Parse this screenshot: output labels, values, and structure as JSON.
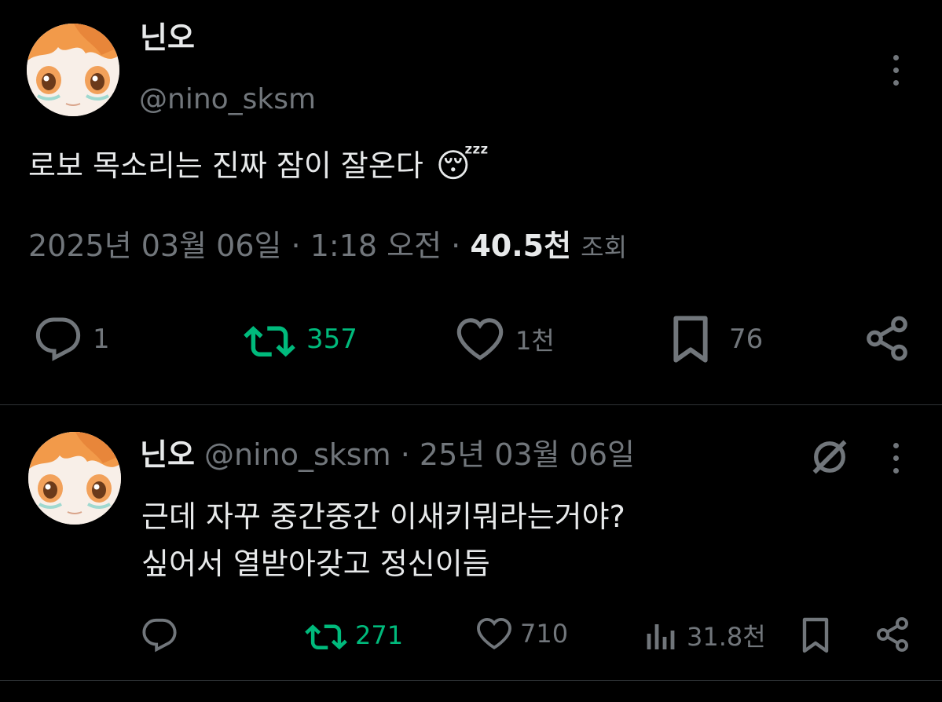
{
  "colors": {
    "background": "#000000",
    "text": "#e7e9ea",
    "muted": "#71767b",
    "repost_green": "#00ba7c",
    "divider": "#2f3336"
  },
  "main_tweet": {
    "author_name": "닌오",
    "handle": "@nino_sksm",
    "text": "로보 목소리는 진짜 잠이 잘온다",
    "emoji": "😴",
    "date": "2025년 03월 06일",
    "sep1": "·",
    "time": "1:18 오전",
    "sep2": "·",
    "views_count": "40.5천",
    "views_label": "조회",
    "actions": {
      "reply_count": "1",
      "repost_count": "357",
      "like_count": "1천",
      "bookmark_count": "76"
    },
    "icons": [
      "more-icon",
      "reply-icon",
      "repost-icon",
      "like-icon",
      "bookmark-icon",
      "share-icon"
    ]
  },
  "reply_tweet": {
    "author_name": "닌오",
    "handle": "@nino_sksm",
    "sep": "·",
    "date": "25년 03월 06일",
    "text_line1": "근데 자꾸 중간중간 이새키뭐라는거야?",
    "text_line2": "싶어서 열받아갖고 정신이듬",
    "actions": {
      "reply_count": "",
      "repost_count": "271",
      "like_count": "710",
      "views_count": "31.8천"
    },
    "icons": [
      "grok-icon",
      "more-icon",
      "reply-icon",
      "repost-icon",
      "like-icon",
      "views-icon",
      "bookmark-icon",
      "share-icon"
    ]
  }
}
